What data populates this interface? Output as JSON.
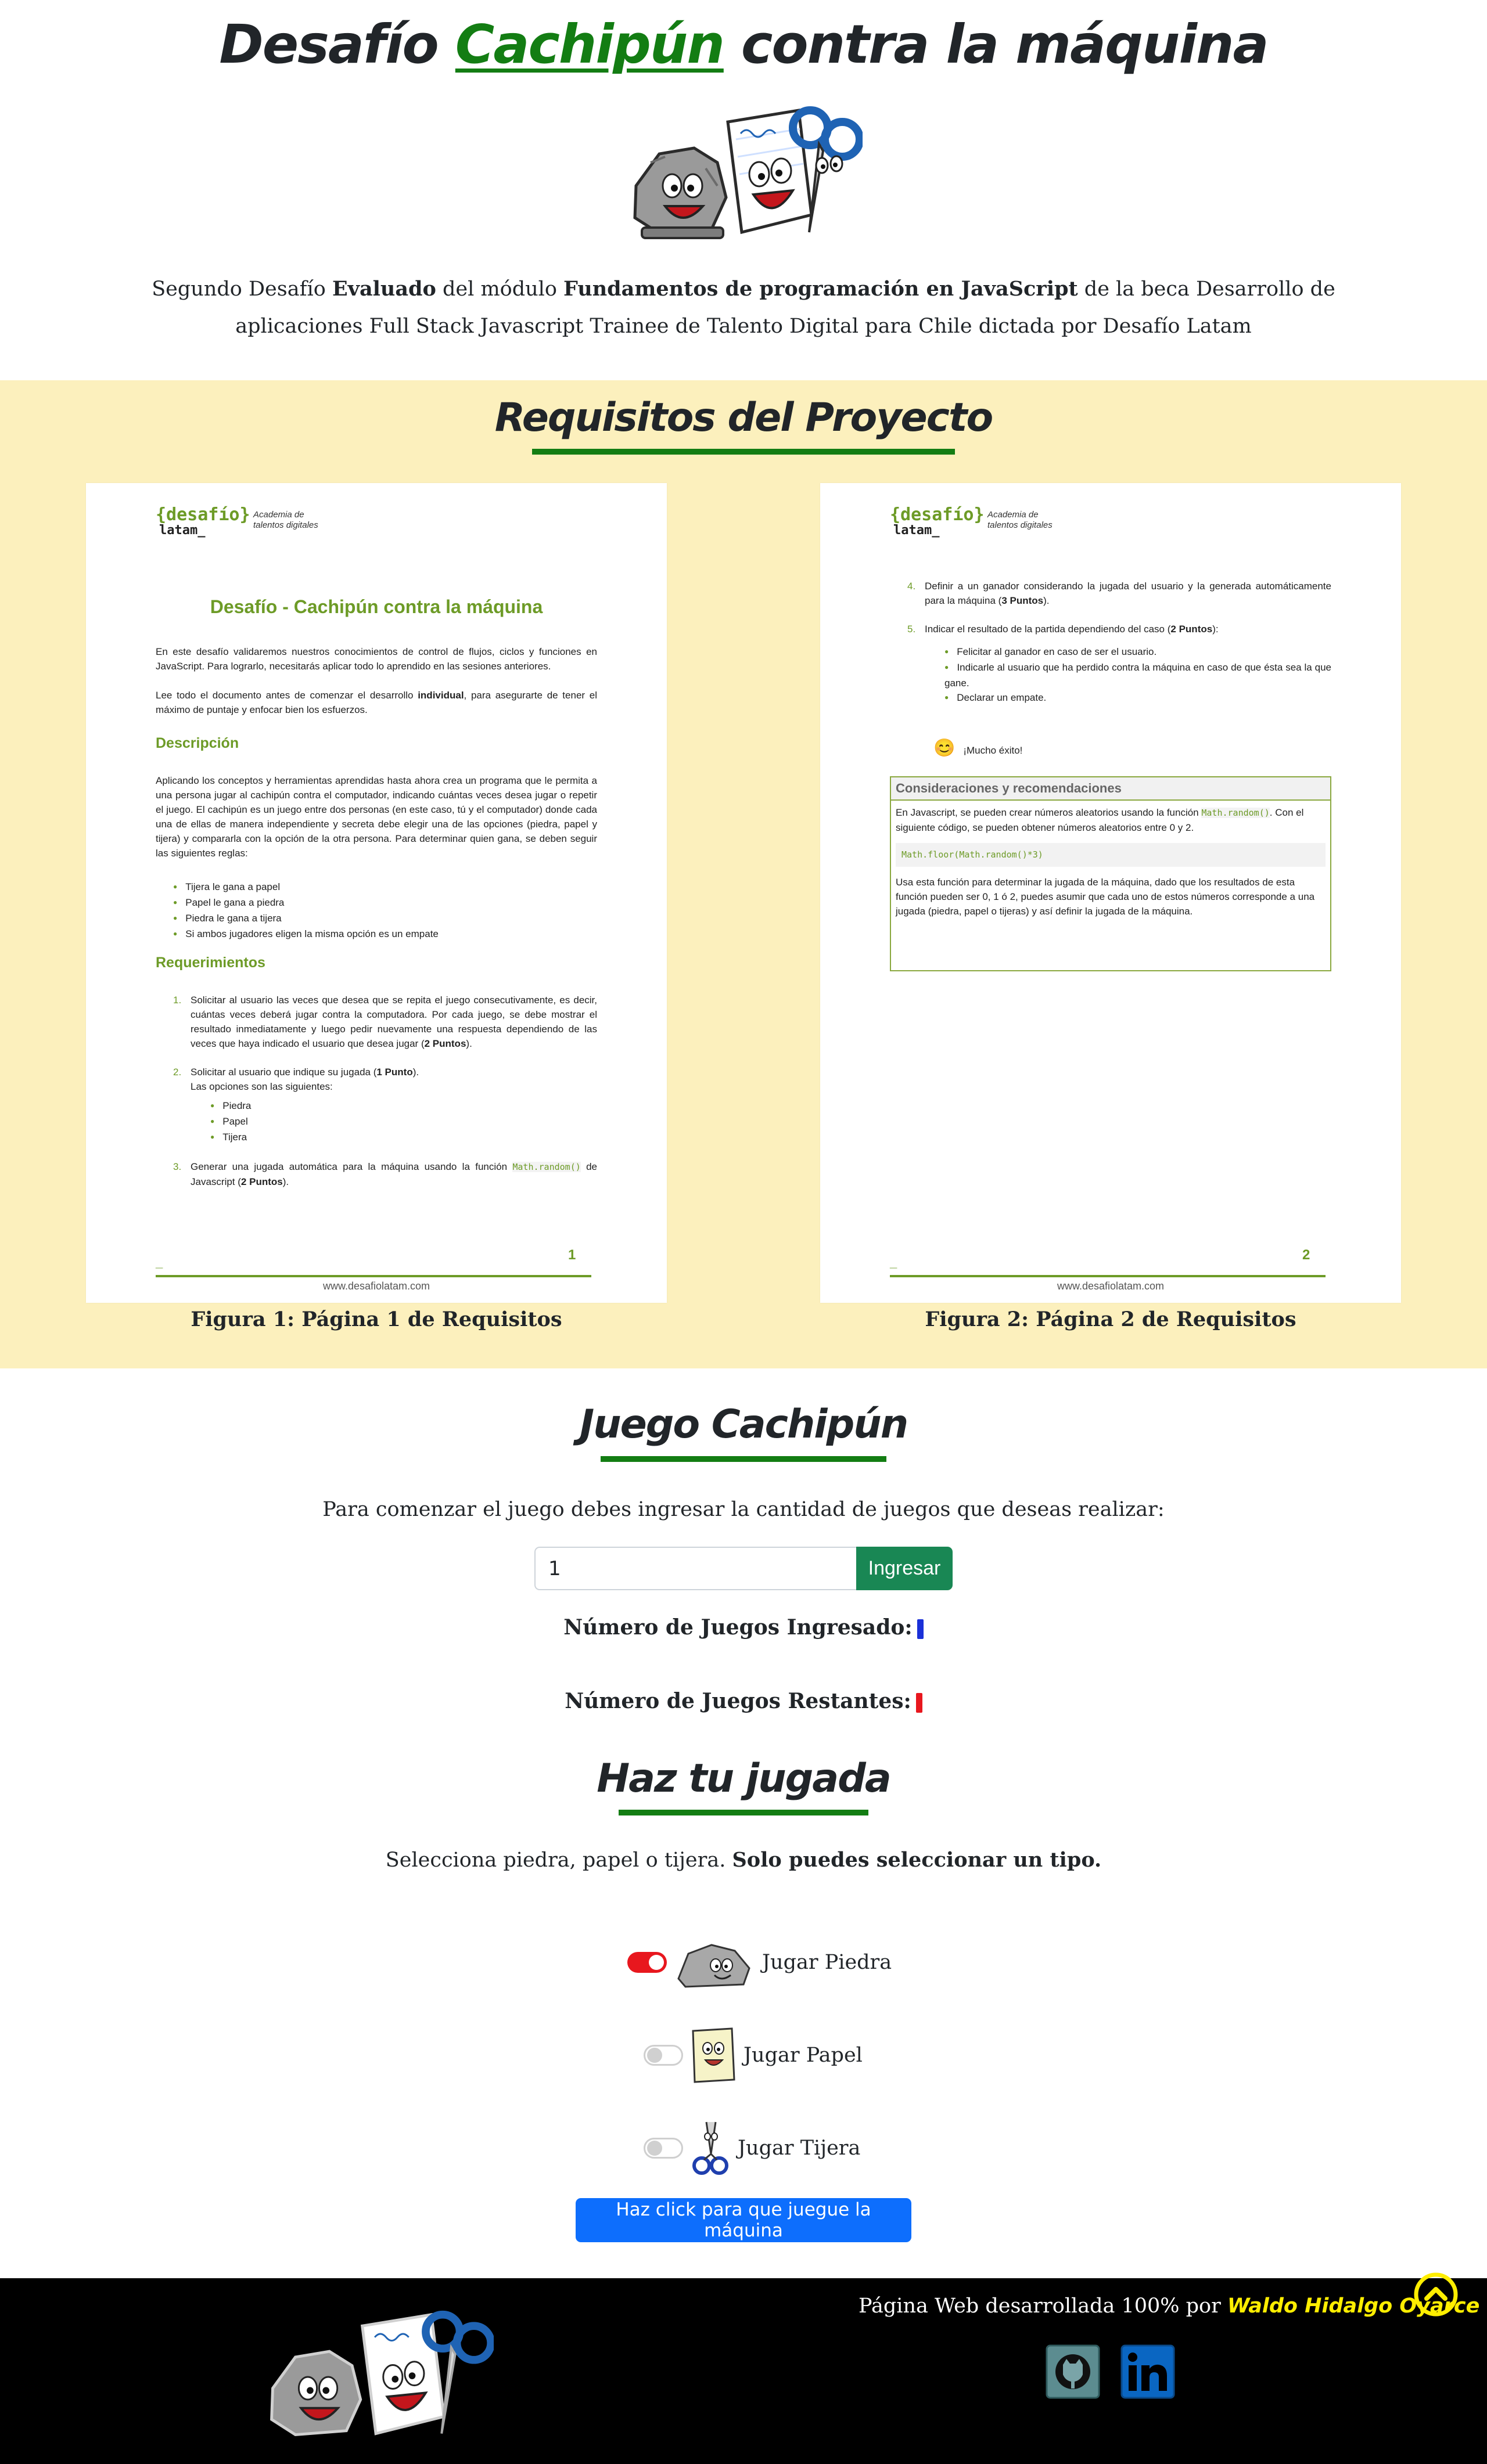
{
  "header": {
    "title_part1": "Desafío ",
    "title_accent": "Cachipún",
    "title_part2": " contra la máquina",
    "intro": {
      "t1": "Segundo Desafío ",
      "b1": "Evaluado",
      "t2": " del módulo ",
      "b2": "Fundamentos de programación en JavaScript",
      "t3": " de la beca Desarrollo de aplicaciones Full Stack Javascript Trainee de Talento Digital para Chile dictada por Desafío Latam"
    }
  },
  "requirements": {
    "title": "Requisitos del Proyecto",
    "logo": {
      "brand1": "{desafío}",
      "brand2": "latam_",
      "tagline1": "Academia de",
      "tagline2": "talentos digitales"
    },
    "page1": {
      "title": "Desafío - Cachipún contra la máquina",
      "p1": "En este desafío validaremos nuestros conocimientos de control de flujos, ciclos y funciones en JavaScript. Para lograrlo, necesitarás aplicar todo lo aprendido en las sesiones anteriores.",
      "p2a": "Lee todo el documento antes de comenzar el desarrollo ",
      "p2b": "individual",
      "p2c": ", para asegurarte de tener el máximo de puntaje y enfocar bien los esfuerzos.",
      "h_desc": "Descripción",
      "desc": "Aplicando los conceptos y herramientas aprendidas hasta ahora crea un programa que le permita a una persona jugar al cachipún contra el computador, indicando cuántas veces desea jugar o repetir el juego. El cachipún es un juego entre dos personas (en este caso, tú y el computador) donde cada una de ellas de manera independiente y secreta debe elegir una de las opciones (piedra, papel y tijera) y compararla con la opción de la otra persona. Para determinar quien gana, se deben seguir las siguientes reglas:",
      "rules": [
        "Tijera le gana a papel",
        "Papel le gana a piedra",
        "Piedra le gana a tijera",
        "Si ambos jugadores eligen la misma opción es un empate"
      ],
      "h_req": "Requerimientos",
      "r1_num": "1.",
      "r1a": "Solicitar al usuario las veces que desea que se repita el juego consecutivamente, es decir, cuántas veces deberá jugar contra la computadora. Por cada juego, se debe mostrar el resultado inmediatamente y luego pedir nuevamente una respuesta dependiendo de las veces que haya indicado el usuario que desea jugar (",
      "r1b": "2 Puntos",
      "r1c": ").",
      "r2_num": "2.",
      "r2a": "Solicitar al usuario que indique su jugada (",
      "r2b": "1 Punto",
      "r2c": ").",
      "r2d": "Las opciones son las siguientes:",
      "options": [
        "Piedra",
        "Papel",
        "Tijera"
      ],
      "r3_num": "3.",
      "r3a": "Generar una jugada automática para la máquina usando la función ",
      "r3code": "Math.random()",
      "r3b": " de Javascript (",
      "r3c": "2 Puntos",
      "r3d": ").",
      "footer_dash": "_",
      "page_num": "1",
      "url": "www.desafiolatam.com"
    },
    "page2": {
      "r4_num": "4.",
      "r4a": "Definir a un ganador considerando la jugada del usuario y la generada automáticamente para la máquina (",
      "r4b": "3 Puntos",
      "r4c": ").",
      "r5_num": "5.",
      "r5a": "Indicar el resultado de la partida dependiendo del caso (",
      "r5b": "2 Puntos",
      "r5c": "):",
      "cases": [
        "Felicitar al ganador en caso de ser el usuario.",
        "Indicarle al usuario que ha perdido contra la máquina en caso de que ésta sea la que gane.",
        "Declarar un empate."
      ],
      "success_icon": "😊",
      "success": "¡Mucho éxito!",
      "consid_title": "Consideraciones y recomendaciones",
      "consid_p1a": "En Javascript, se pueden crear números aleatorios usando la función ",
      "consid_code_inline": "Math.random()",
      "consid_p1b": ". Con el siguiente código, se pueden obtener números aleatorios entre 0 y 2.",
      "consid_code": "Math.floor(Math.random()*3)",
      "consid_p2": "Usa esta función para determinar la jugada de la máquina, dado que los resultados de esta función pueden ser 0, 1 ó 2, puedes asumir que cada uno de estos números corresponde a una jugada (piedra, papel o tijeras) y así definir la jugada de la máquina.",
      "footer_dash": "_",
      "page_num": "2",
      "url": "www.desafiolatam.com"
    },
    "caption1": "Figura 1: Página 1 de Requisitos",
    "caption2": "Figura 2: Página 2 de Requisitos"
  },
  "game": {
    "title": "Juego Cachipún",
    "prompt": "Para comenzar el juego debes ingresar la cantidad de juegos que deseas realizar:",
    "input_value": "1",
    "submit_label": "Ingresar",
    "entered_label": "Número de Juegos Ingresado:",
    "remaining_label": "Número de Juegos Restantes:",
    "entered_color": "#1a30d8",
    "remaining_color": "#e8171e"
  },
  "play": {
    "title": "Haz tu jugada",
    "instruction_a": "Selecciona piedra, papel o tijera. ",
    "instruction_b": "Solo puedes seleccionar un tipo.",
    "choices": [
      {
        "label": "Jugar Piedra",
        "checked": true,
        "icon": "rock-icon"
      },
      {
        "label": "Jugar Papel",
        "checked": false,
        "icon": "paper-icon"
      },
      {
        "label": "Jugar Tijera",
        "checked": false,
        "icon": "scissors-icon"
      }
    ],
    "machine_button": "Haz click para que juegue la máquina"
  },
  "footer": {
    "credit_prefix": "Página Web desarrollada 100% por ",
    "author": "Waldo Hidalgo Oyarce",
    "social": [
      "github-icon",
      "linkedin-icon"
    ]
  },
  "colors": {
    "accent_green": "#137d13",
    "section_bg": "#fcf0bd",
    "doc_green": "#6d9b27",
    "primary": "#0d6efd",
    "success": "#198754",
    "author_yellow": "#ffee00"
  }
}
